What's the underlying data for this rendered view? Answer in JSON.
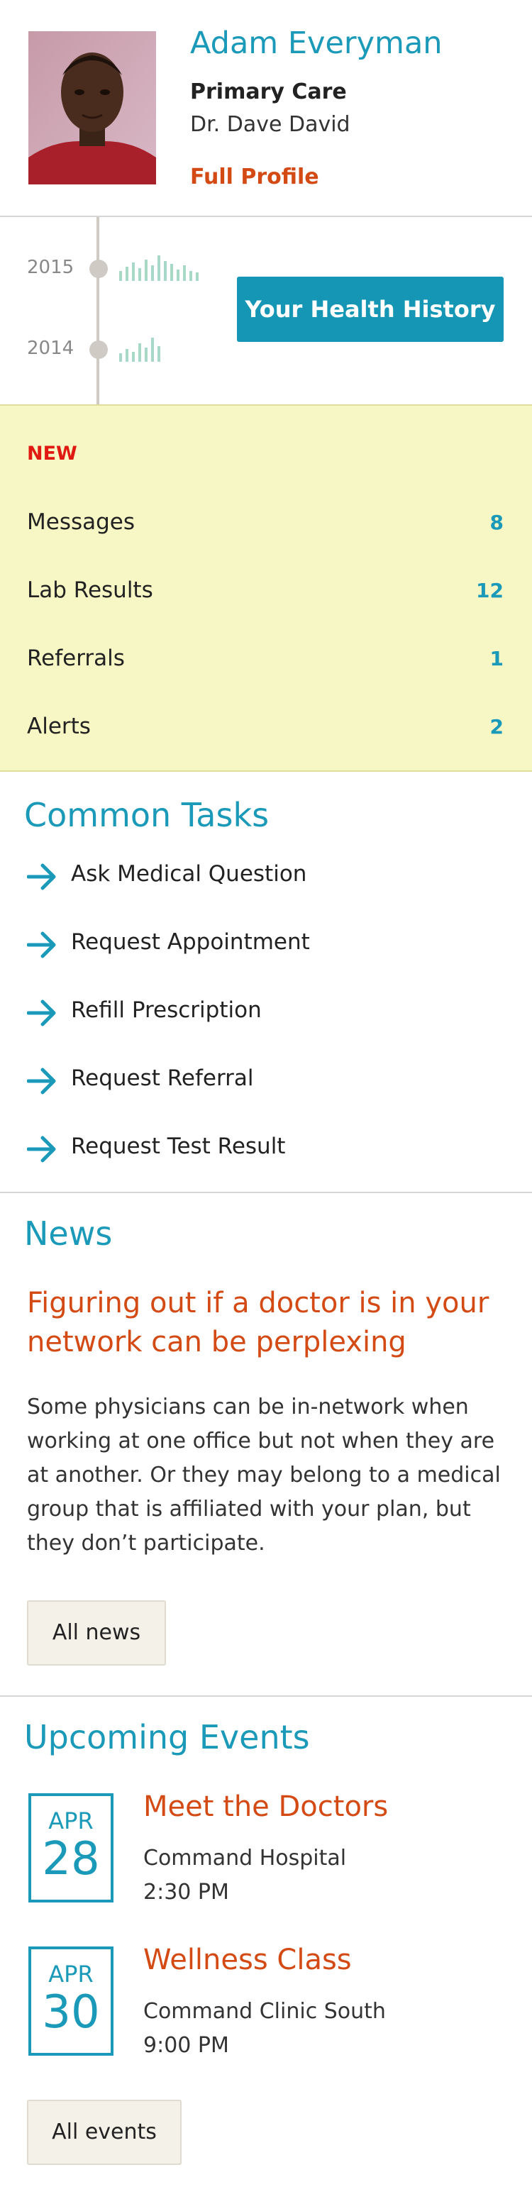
{
  "profile": {
    "name": "Adam Everyman",
    "care_type": "Primary Care",
    "doctor": "Dr. Dave David",
    "full_profile_link": "Full Profile"
  },
  "history": {
    "years": [
      "2015",
      "2014"
    ],
    "button_label": "Your Health History"
  },
  "new_items": {
    "label": "NEW",
    "rows": [
      {
        "label": "Messages",
        "count": "8"
      },
      {
        "label": "Lab Results",
        "count": "12"
      },
      {
        "label": "Referrals",
        "count": "1"
      },
      {
        "label": "Alerts",
        "count": "2"
      }
    ]
  },
  "common_tasks": {
    "title": "Common Tasks",
    "items": [
      "Ask Medical Question",
      "Request Appointment",
      "Refill Prescription",
      "Request Referral",
      "Request Test Result"
    ]
  },
  "news": {
    "title": "News",
    "headline": "Figuring out if a doctor is in your network can be perplexing",
    "body": "Some physicians can be in-network when working at one office but not when they are at another. Or they may belong to a medical group that is affiliated with your plan, but they don’t participate.",
    "all_button": "All news"
  },
  "events": {
    "title": "Upcoming Events",
    "items": [
      {
        "month": "APR",
        "day": "28",
        "title": "Meet the Doctors",
        "location": "Command Hospital",
        "time": "2:30 PM"
      },
      {
        "month": "APR",
        "day": "30",
        "title": "Wellness Class",
        "location": "Command Clinic South",
        "time": "9:00 PM"
      }
    ],
    "all_button": "All events"
  },
  "colors": {
    "accent": "#1a9ab8",
    "link_orange": "#d44a14",
    "new_red": "#e01a12",
    "new_bg": "#f7f6c5",
    "button_blue": "#1496b4"
  },
  "icons": {
    "task_arrow": "arrow-right-icon",
    "history_spark": "sparkline-bars-icon"
  }
}
